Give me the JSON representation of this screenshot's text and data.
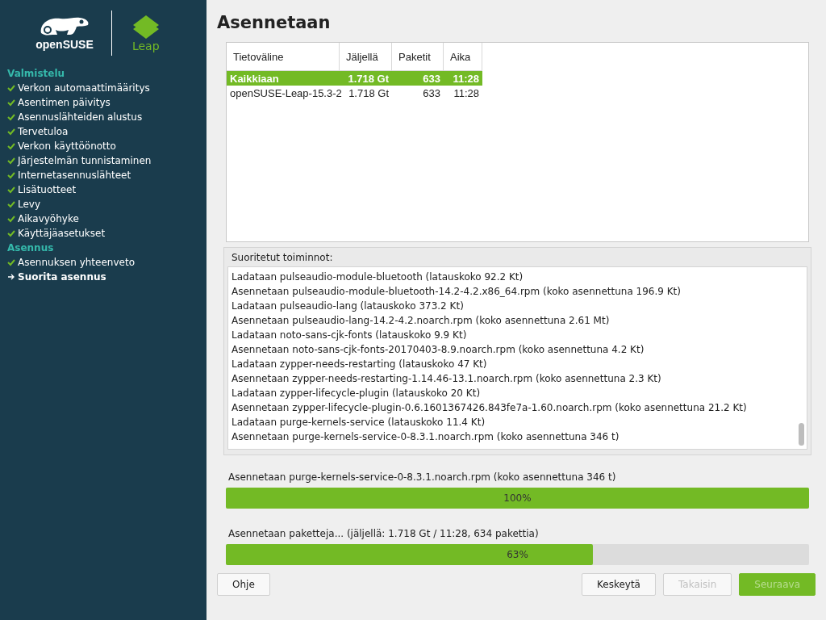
{
  "sidebar": {
    "logo_text": "openSUSE",
    "product": "Leap",
    "sections": [
      {
        "title": "Valmistelu",
        "items": [
          {
            "label": "Verkon automaattimääritys",
            "kind": "done"
          },
          {
            "label": "Asentimen päivitys",
            "kind": "done"
          },
          {
            "label": "Asennuslähteiden alustus",
            "kind": "done"
          },
          {
            "label": "Tervetuloa",
            "kind": "done"
          },
          {
            "label": "Verkon käyttöönotto",
            "kind": "done"
          },
          {
            "label": "Järjestelmän tunnistaminen",
            "kind": "done"
          },
          {
            "label": "Internetasennuslähteet",
            "kind": "done"
          },
          {
            "label": "Lisätuotteet",
            "kind": "done"
          },
          {
            "label": "Levy",
            "kind": "done"
          },
          {
            "label": "Aikavyöhyke",
            "kind": "done"
          },
          {
            "label": "Käyttäjäasetukset",
            "kind": "done"
          }
        ]
      },
      {
        "title": "Asennus",
        "items": [
          {
            "label": "Asennuksen yhteenveto",
            "kind": "done"
          },
          {
            "label": "Suorita asennus",
            "kind": "current"
          }
        ]
      }
    ]
  },
  "title": "Asennetaan",
  "table": {
    "columns": [
      "Tietoväline",
      "Jäljellä",
      "Paketit",
      "Aika"
    ],
    "rows": [
      {
        "cells": [
          "Kaikkiaan",
          "1.718 Gt",
          "633",
          "11:28"
        ],
        "selected": true
      },
      {
        "cells": [
          "openSUSE-Leap-15.3-2",
          "1.718 Gt",
          "633",
          "11:28"
        ],
        "selected": false
      }
    ]
  },
  "log": {
    "label": "Suoritetut toiminnot:",
    "lines": [
      "Ladataan pulseaudio-module-bluetooth (latauskoko 92.2 Kt)",
      "Asennetaan pulseaudio-module-bluetooth-14.2-4.2.x86_64.rpm (koko asennettuna 196.9 Kt)",
      "Ladataan pulseaudio-lang (latauskoko 373.2 Kt)",
      "Asennetaan pulseaudio-lang-14.2-4.2.noarch.rpm (koko asennettuna 2.61 Mt)",
      "Ladataan noto-sans-cjk-fonts (latauskoko 9.9 Kt)",
      "Asennetaan noto-sans-cjk-fonts-20170403-8.9.noarch.rpm (koko asennettuna 4.2 Kt)",
      "Ladataan zypper-needs-restarting (latauskoko 47 Kt)",
      "Asennetaan zypper-needs-restarting-1.14.46-13.1.noarch.rpm (koko asennettuna 2.3 Kt)",
      "Ladataan zypper-lifecycle-plugin (latauskoko 20 Kt)",
      "Asennetaan zypper-lifecycle-plugin-0.6.1601367426.843fe7a-1.60.noarch.rpm (koko asennettuna 21.2 Kt)",
      "Ladataan purge-kernels-service (latauskoko 11.4 Kt)",
      "Asennetaan purge-kernels-service-0-8.3.1.noarch.rpm (koko asennettuna 346 t)"
    ]
  },
  "progress": [
    {
      "label": "Asennetaan purge-kernels-service-0-8.3.1.noarch.rpm (koko asennettuna 346 t)",
      "level": 1,
      "percent": "100%"
    },
    {
      "label": "Asennetaan paketteja... (jäljellä: 1.718 Gt / 11:28, 634 pakettia)",
      "level": 0.63,
      "percent": "63%"
    }
  ],
  "buttons": [
    {
      "label": "Ohje",
      "kind": "normal",
      "disabled": false
    },
    {
      "label": "Keskeytä",
      "kind": "normal",
      "disabled": false
    },
    {
      "label": "Takaisin",
      "kind": "normal",
      "disabled": true
    },
    {
      "label": "Seuraava",
      "kind": "primary",
      "disabled": true
    }
  ]
}
